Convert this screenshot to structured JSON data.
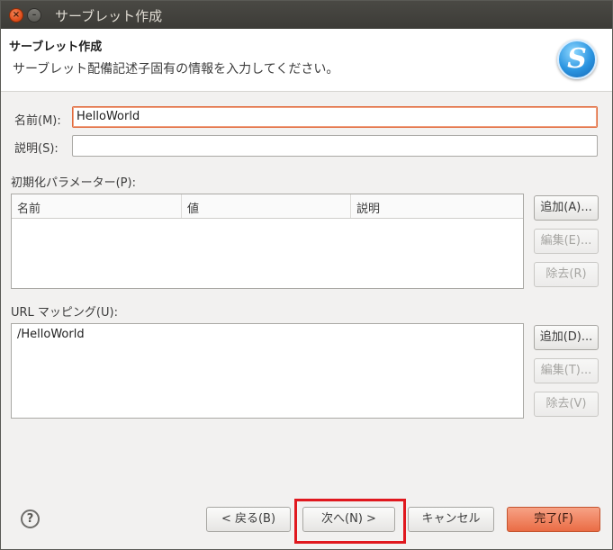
{
  "window": {
    "title": "サーブレット作成",
    "close_glyph": "×",
    "min_glyph": "–"
  },
  "header": {
    "title": "サーブレット作成",
    "description": "サーブレット配備記述子固有の情報を入力してください。",
    "logo_letter": "S"
  },
  "form": {
    "name_label": "名前(M):",
    "name_value": "HelloWorld",
    "desc_label": "説明(S):",
    "desc_value": ""
  },
  "init_params": {
    "label": "初期化パラメーター(P):",
    "columns": [
      "名前",
      "値",
      "説明"
    ],
    "add_button": "追加(A)...",
    "edit_button": "編集(E)...",
    "remove_button": "除去(R)"
  },
  "url_mappings": {
    "label": "URL マッピング(U):",
    "items": [
      "/HelloWorld"
    ],
    "add_button": "追加(D)...",
    "edit_button": "編集(T)...",
    "remove_button": "除去(V)"
  },
  "footer": {
    "help_glyph": "?",
    "back_button": "< 戻る(B)",
    "next_button": "次へ(N) >",
    "cancel_button": "キャンセル",
    "finish_button": "完了(F)"
  },
  "colors": {
    "accent": "#ea6c45",
    "highlight": "#e0181e"
  }
}
